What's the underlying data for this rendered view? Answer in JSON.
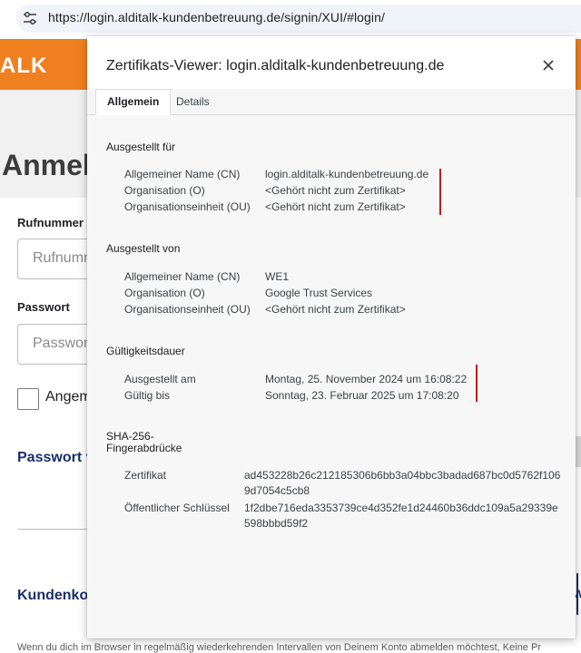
{
  "browser": {
    "url": "https://login.alditalk-kundenbetreuung.de/signin/XUI/#login/"
  },
  "background_page": {
    "brand": "ALK",
    "headline": "Anmelde",
    "phone_label": "Rufnummer",
    "phone_placeholder": "Rufnummer",
    "password_label": "Passwort",
    "password_placeholder": "Passwort",
    "remember_label": "Angem",
    "forgot_password_link": "Passwort v",
    "customer_account_link": "Kundenkon",
    "right_char": "w",
    "bottom_text": "Wenn du dich im Browser in regelmäßig wiederkehrenden Intervallen von Deinem Konto abmelden möchtest, Keine Pr"
  },
  "dialog": {
    "title": "Zertifikats-Viewer: login.alditalk-kundenbetreuung.de",
    "close_icon": "close-icon",
    "tabs": [
      {
        "label": "Allgemein",
        "active": true
      },
      {
        "label": "Details",
        "active": false
      }
    ],
    "issued_to": {
      "heading": "Ausgestellt für",
      "rows": [
        {
          "key": "Allgemeiner Name (CN)",
          "value": "login.alditalk-kundenbetreuung.de"
        },
        {
          "key": "Organisation (O)",
          "value": "<Gehört nicht zum Zertifikat>"
        },
        {
          "key": "Organisationseinheit (OU)",
          "value": "<Gehört nicht zum Zertifikat>"
        }
      ]
    },
    "issued_by": {
      "heading": "Ausgestellt von",
      "rows": [
        {
          "key": "Allgemeiner Name (CN)",
          "value": "WE1"
        },
        {
          "key": "Organisation (O)",
          "value": "Google Trust Services"
        },
        {
          "key": "Organisationseinheit (OU)",
          "value": "<Gehört nicht zum Zertifikat>"
        }
      ]
    },
    "validity": {
      "heading": "Gültigkeitsdauer",
      "rows": [
        {
          "key": "Ausgestellt am",
          "value": "Montag, 25. November 2024 um 16:08:22"
        },
        {
          "key": "Gültig bis",
          "value": "Sonntag, 23. Februar 2025 um 17:08:20"
        }
      ]
    },
    "fingerprints": {
      "heading": "SHA-256-Fingerabdrücke",
      "rows": [
        {
          "key": "Zertifikat",
          "value": "ad453228b26c212185306b6bb3a04bbc3badad687bc0d5762f1069d7054c5cb8"
        },
        {
          "key": "Öffentlicher Schlüssel",
          "value": "1f2dbe716eda3353739ce4d352fe1d24460b36ddc109a5a29339e598bbbd59f2"
        }
      ]
    },
    "highlight_color": "#c6161e"
  }
}
